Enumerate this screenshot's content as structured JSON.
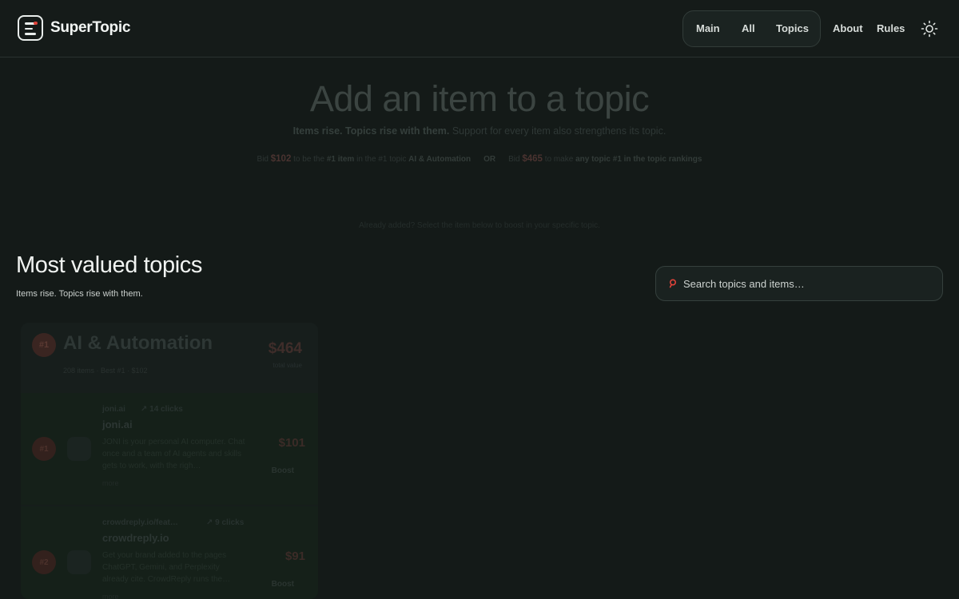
{
  "header": {
    "brand": "SuperTopic",
    "nav_pill": [
      "Main",
      "All",
      "Topics"
    ],
    "nav_links": [
      "About",
      "Rules"
    ],
    "theme_icon": "sun-icon"
  },
  "hero": {
    "title": "Add an item to a topic",
    "subtitle_bold": "Items rise. Topics rise with them.",
    "subtitle_rest": " Support for every item also strengthens its topic.",
    "offer": {
      "bid1_prefix": "Bid ",
      "bid1_price": "$102",
      "bid1_mid": " to be the ",
      "bid1_bold": "#1 item",
      "bid1_mid2": " in the #1 topic ",
      "bid1_topic": "AI & Automation",
      "or": "OR",
      "bid2_prefix": "Bid ",
      "bid2_price": "$465",
      "bid2_mid": " to make ",
      "bid2_bold": "any topic #1 in the topic rankings"
    },
    "note": "Already added? Select the item below to boost in your specific topic."
  },
  "section": {
    "title": "Most valued topics",
    "subtitle": "Items rise. Topics rise with them."
  },
  "search": {
    "placeholder": "Search topics and items…",
    "icon": "search-icon"
  },
  "topic": {
    "rank": "#1",
    "name": "AI & Automation",
    "meta": "208 items · Best #1 · $102",
    "value": "$464",
    "value_label": "total value",
    "items": [
      {
        "rank": "#1",
        "domain": "joni.ai",
        "clicks": "↗ 14 clicks",
        "name": "joni.ai",
        "description": "JONI is your personal AI computer. Chat once and a team of AI agents and skills gets to work, with the righ…",
        "more": "more",
        "price": "$101",
        "boost": "Boost"
      },
      {
        "rank": "#2",
        "domain": "crowdreply.io/feat…",
        "clicks": "↗ 9 clicks",
        "name": "crowdreply.io",
        "description": "Get your brand added to the pages ChatGPT, Gemini, and Perplexity already cite. CrowdReply runs the…",
        "more": "more",
        "price": "$91",
        "boost": "Boost"
      }
    ]
  },
  "colors": {
    "background": "#141a18",
    "accent": "#e0433a"
  }
}
